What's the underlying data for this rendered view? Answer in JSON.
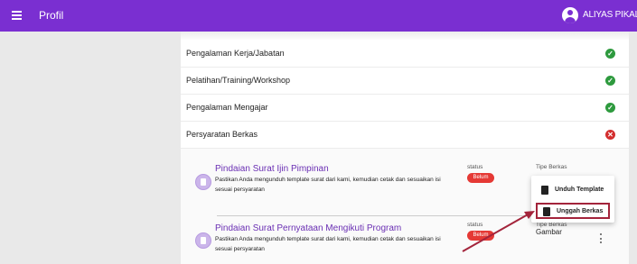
{
  "colors": {
    "brand": "#7a2fd1",
    "ok": "#2e9a3e",
    "error": "#d32f2f",
    "badge": "#e53935",
    "highlight": "#a3243b"
  },
  "header": {
    "title": "Profil",
    "user_name": "ALIYAS PIKAL",
    "menu_icon": "hamburger-icon",
    "avatar_icon": "account-circle-icon"
  },
  "sections": [
    {
      "label": "Pengalaman Kerja/Jabatan",
      "status": "complete"
    },
    {
      "label": "Pelatihan/Training/Workshop",
      "status": "complete"
    },
    {
      "label": "Pengalaman Mengajar",
      "status": "complete"
    },
    {
      "label": "Persyaratan Berkas",
      "status": "incomplete"
    }
  ],
  "documents": [
    {
      "title": "Pindaian Surat Ijin Pimpinan",
      "description": "Pastikan Anda mengunduh template surat dari kami, kemudian cetak dan sesuaikan isi sesuai persyaratan",
      "status_label": "status",
      "status": "Belum",
      "type_label": "Tipe Berkas",
      "type": ""
    },
    {
      "title": "Pindaian Surat Pernyataan Mengikuti Program",
      "description": "Pastikan Anda mengunduh template surat dari kami, kemudian cetak dan sesuaikan isi sesuai persyaratan",
      "status_label": "status",
      "status": "Belum",
      "type_label": "Tipe Berkas",
      "type": "Gambar"
    }
  ],
  "context_menu": [
    {
      "label": "Unduh Template",
      "icon": "file-download-icon",
      "highlighted": false
    },
    {
      "label": "Unggah Berkas",
      "icon": "file-upload-icon",
      "highlighted": true
    }
  ]
}
